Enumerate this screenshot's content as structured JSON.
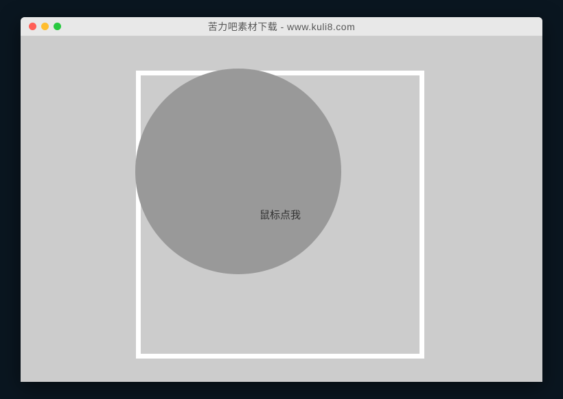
{
  "window": {
    "title": "苦力吧素材下载 - www.kuli8.com"
  },
  "canvas": {
    "center_label": "鼠标点我"
  }
}
